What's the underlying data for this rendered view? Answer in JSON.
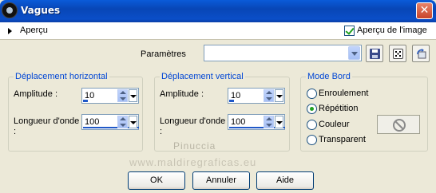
{
  "window": {
    "title": "Vagues"
  },
  "preview": {
    "label": "Aperçu",
    "image_preview_label": "Aperçu de l'image",
    "image_preview_checked": true
  },
  "params": {
    "label": "Paramètres",
    "value": ""
  },
  "horizontal": {
    "title": "Déplacement horizontal",
    "amplitude_label": "Amplitude :",
    "amplitude_value": "10",
    "wavelength_label_1": "Longueur d'onde",
    "wavelength_label_2": ":",
    "wavelength_value": "100"
  },
  "vertical": {
    "title": "Déplacement vertical",
    "amplitude_label": "Amplitude :",
    "amplitude_value": "10",
    "wavelength_label_1": "Longueur d'onde",
    "wavelength_label_2": ":",
    "wavelength_value": "100"
  },
  "edge": {
    "title": "Mode Bord",
    "options": [
      "Enroulement",
      "Répétition",
      "Couleur",
      "Transparent"
    ],
    "selected": "Répétition"
  },
  "watermark": {
    "line1": "Pinuccia",
    "line2": "www.maldiregraficas.eu"
  },
  "buttons": {
    "ok": "OK",
    "cancel": "Annuler",
    "help": "Aide"
  },
  "colors": {
    "title_bar": "#0a4ec8",
    "group_title": "#0046d5",
    "dialog_bg": "#ece9d8"
  },
  "icons": [
    "app-icon",
    "close-icon",
    "expand-arrow-icon",
    "save-icon",
    "dice-icon",
    "reset-icon",
    "no-color-icon"
  ]
}
